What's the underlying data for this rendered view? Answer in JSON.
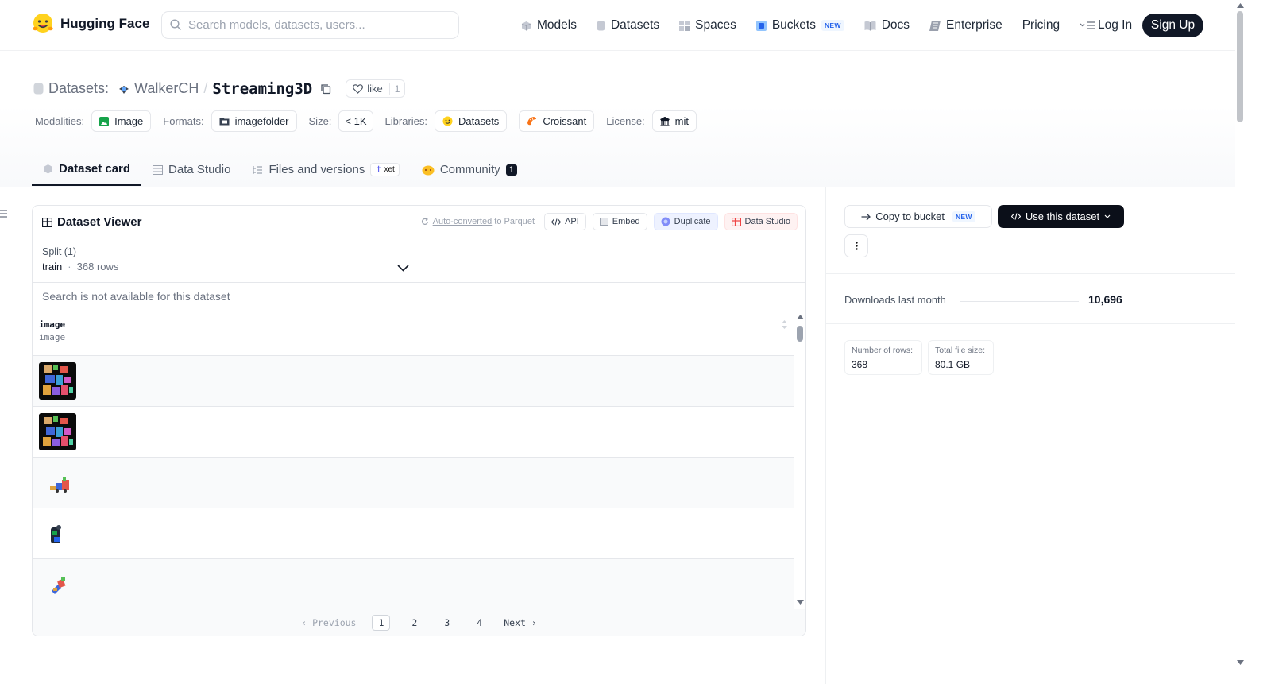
{
  "nav": {
    "brand": "Hugging Face",
    "search_placeholder": "Search models, datasets, users...",
    "items": [
      {
        "label": "Models",
        "icon": "cube-icon"
      },
      {
        "label": "Datasets",
        "icon": "database-icon"
      },
      {
        "label": "Spaces",
        "icon": "grid-icon"
      },
      {
        "label": "Buckets",
        "icon": "bucket-icon",
        "badge": "NEW"
      },
      {
        "label": "Docs",
        "icon": "book-icon"
      },
      {
        "label": "Enterprise",
        "icon": "enterprise-icon"
      },
      {
        "label": "Pricing"
      }
    ],
    "login": "Log In",
    "signup": "Sign Up"
  },
  "header": {
    "prefix": "Datasets:",
    "owner": "WalkerCH",
    "sep": "/",
    "name": "Streaming3D",
    "like_label": "like",
    "like_count": "1",
    "tags": {
      "modalities_label": "Modalities:",
      "modality": "Image",
      "formats_label": "Formats:",
      "format": "imagefolder",
      "size_label": "Size:",
      "size": "< 1K",
      "libraries_label": "Libraries:",
      "library1": "Datasets",
      "library2": "Croissant",
      "license_label": "License:",
      "license": "mit"
    }
  },
  "tabs": {
    "card": "Dataset card",
    "studio": "Data Studio",
    "files": "Files and versions",
    "xet": "xet",
    "community": "Community",
    "community_count": "1"
  },
  "viewer": {
    "title": "Dataset Viewer",
    "auto": "Auto-converted",
    "auto_suffix": " to Parquet",
    "api": "API",
    "embed": "Embed",
    "duplicate": "Duplicate",
    "studio": "Data Studio",
    "split_label": "Split (1)",
    "split_name": "train",
    "split_rows": "368 rows",
    "search_na": "Search is not available for this dataset",
    "col_name": "image",
    "col_type": "image",
    "pager": {
      "prev": "Previous",
      "next": "Next",
      "pages": [
        "1",
        "2",
        "3",
        "4"
      ]
    }
  },
  "side": {
    "copy_bucket": "Copy to bucket",
    "copy_badge": "NEW",
    "use_dataset": "Use this dataset",
    "downloads_label": "Downloads last month",
    "downloads": "10,696",
    "rows_label": "Number of rows:",
    "rows": "368",
    "size_label": "Total file size:",
    "size": "80.1 GB"
  }
}
